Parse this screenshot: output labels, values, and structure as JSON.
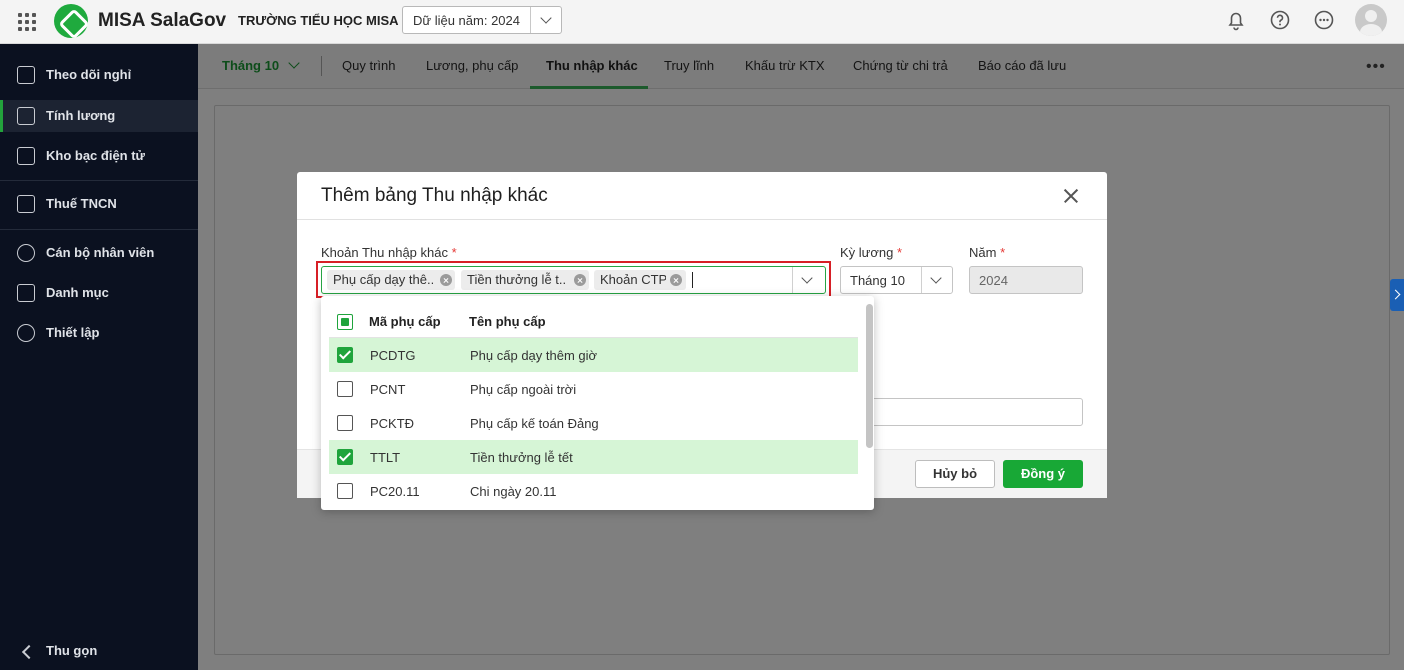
{
  "app": {
    "brand": "MISA SalaGov",
    "school": "TRƯỜNG TIỂU HỌC MISA",
    "year_selector": "Dữ liệu năm: 2024"
  },
  "sidebar": {
    "items": [
      {
        "label": "Theo dõi nghỉ",
        "icon": "calendar-icon"
      },
      {
        "label": "Tính lương",
        "icon": "money-icon"
      },
      {
        "label": "Kho bạc điện tử",
        "icon": "monitor-icon"
      },
      {
        "label": "Thuế TNCN",
        "icon": "document-icon"
      },
      {
        "label": "Cán bộ nhân viên",
        "icon": "people-icon"
      },
      {
        "label": "Danh mục",
        "icon": "list-icon"
      },
      {
        "label": "Thiết lập",
        "icon": "gear-icon"
      }
    ],
    "collapse": "Thu gọn"
  },
  "tabs": {
    "month": "Tháng 10",
    "items": [
      "Quy trình",
      "Lương, phụ cấp",
      "Thu nhập khác",
      "Truy lĩnh",
      "Khấu trừ KTX",
      "Chứng từ chi trả",
      "Báo cáo đã lưu"
    ],
    "active": "Thu nhập khác"
  },
  "modal": {
    "title": "Thêm bảng Thu nhập khác",
    "income_label": "Khoản Thu nhập khác",
    "required": "*",
    "tags": [
      "Phụ cấp dạy thê...",
      "Tiền thưởng lễ t...",
      "Khoản CTP"
    ],
    "period_label": "Kỳ lương",
    "period_value": "Tháng 10",
    "year_label": "Năm",
    "year_value": "2024",
    "cancel": "Hủy bỏ",
    "ok": "Đồng ý"
  },
  "dropdown": {
    "col_code": "Mã phụ cấp",
    "col_name": "Tên phụ cấp",
    "rows": [
      {
        "code": "PCDTG",
        "name": "Phụ cấp dạy thêm giờ",
        "checked": true
      },
      {
        "code": "PCNT",
        "name": "Phụ cấp ngoài trời",
        "checked": false
      },
      {
        "code": "PCKTĐ",
        "name": "Phụ cấp kế toán Đảng",
        "checked": false
      },
      {
        "code": "TTLT",
        "name": "Tiền thưởng lễ tết",
        "checked": true
      },
      {
        "code": "PC20.11",
        "name": "Chi ngày 20.11",
        "checked": false
      }
    ]
  },
  "colors": {
    "accent": "#18a836",
    "sidebar_bg": "#0b1120",
    "highlight": "#d71f26",
    "selected_row": "#d6f5d6"
  }
}
